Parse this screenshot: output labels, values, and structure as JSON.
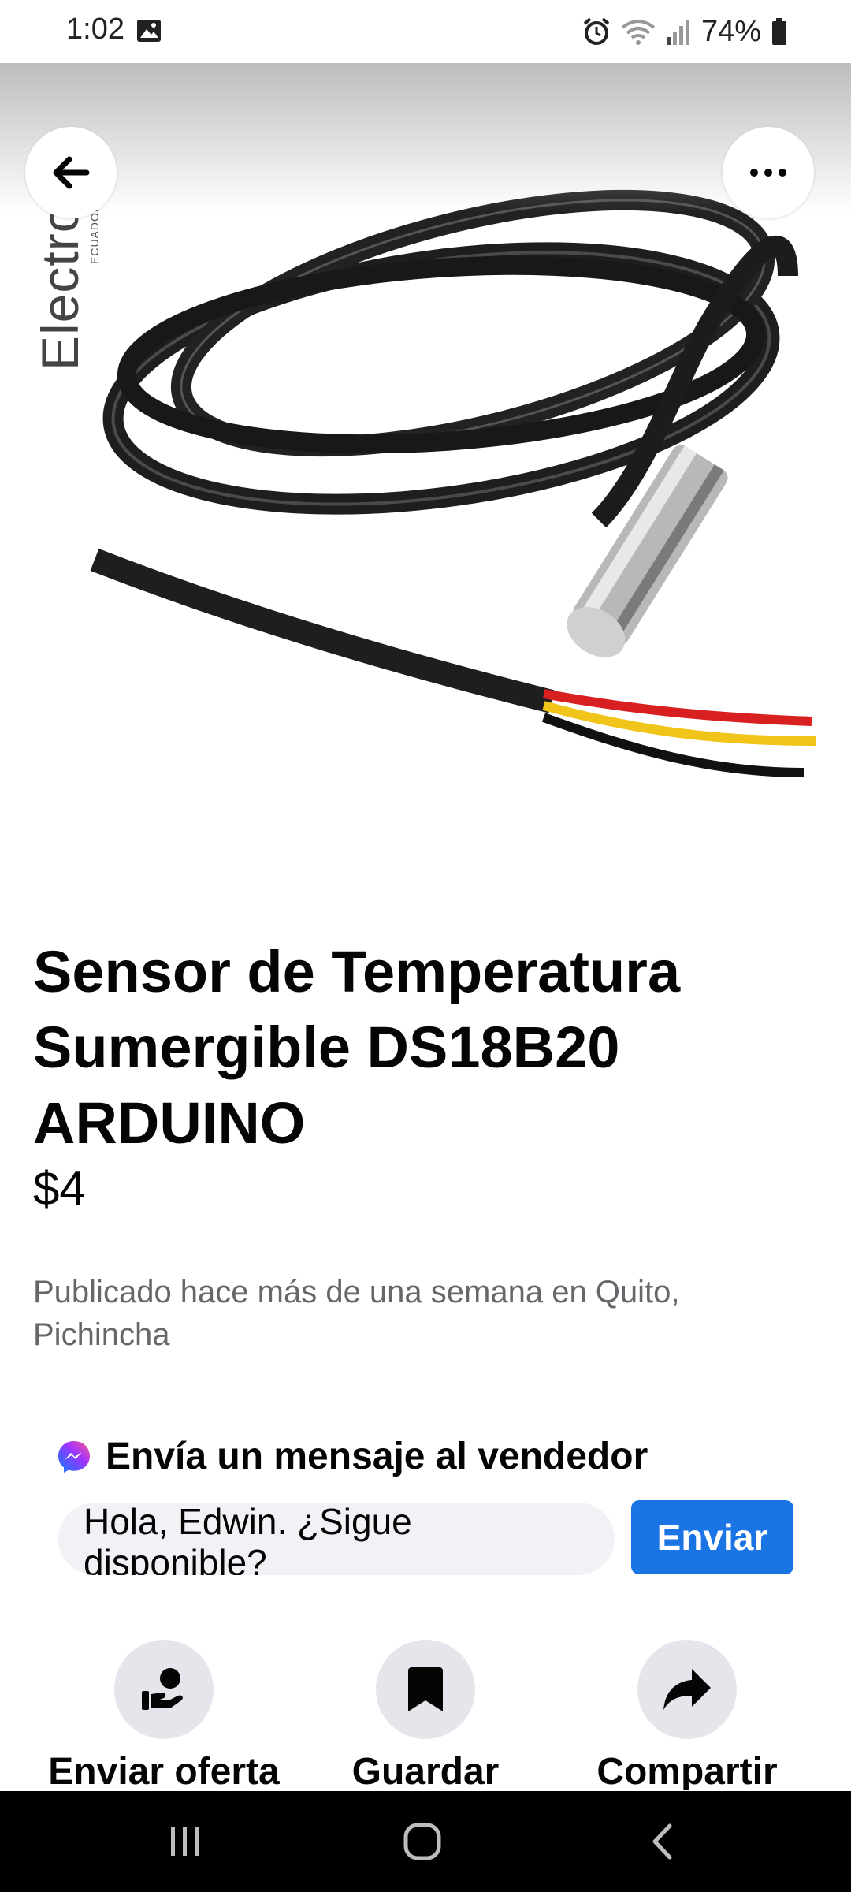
{
  "status_bar": {
    "time": "1:02",
    "battery": "74%",
    "icons": [
      "gallery-icon",
      "alarm-icon",
      "wifi-icon",
      "signal-icon",
      "battery-icon"
    ]
  },
  "hero": {
    "watermark": "Electronic",
    "watermark_sub": "ECUADOR",
    "image": "black-waterproof-temperature-probe-cable-photo"
  },
  "toolbar": {
    "back_icon": "arrow-left-icon",
    "more_icon": "more-horizontal-icon"
  },
  "listing": {
    "title": "Sensor de Temperatura Sumergible DS18B20 ARDUINO",
    "price": "$4",
    "posted": "Publicado hace más de una semana en Quito, Pichincha"
  },
  "message": {
    "header": "Envía un mensaje al vendedor",
    "input_value": "Hola, Edwin. ¿Sigue disponible?",
    "send_label": "Enviar"
  },
  "actions": [
    {
      "label": "Enviar oferta",
      "icon": "offer-icon"
    },
    {
      "label": "Guardar",
      "icon": "bookmark-icon"
    },
    {
      "label": "Compartir",
      "icon": "share-icon"
    }
  ],
  "nav_bar": {
    "icons": [
      "recent-apps-icon",
      "home-icon",
      "back-nav-icon"
    ]
  },
  "colors": {
    "accent": "#1b74e4",
    "secondary_text": "#65676b",
    "action_bg": "#e4e6eb",
    "input_bg": "#f0f2f5"
  }
}
